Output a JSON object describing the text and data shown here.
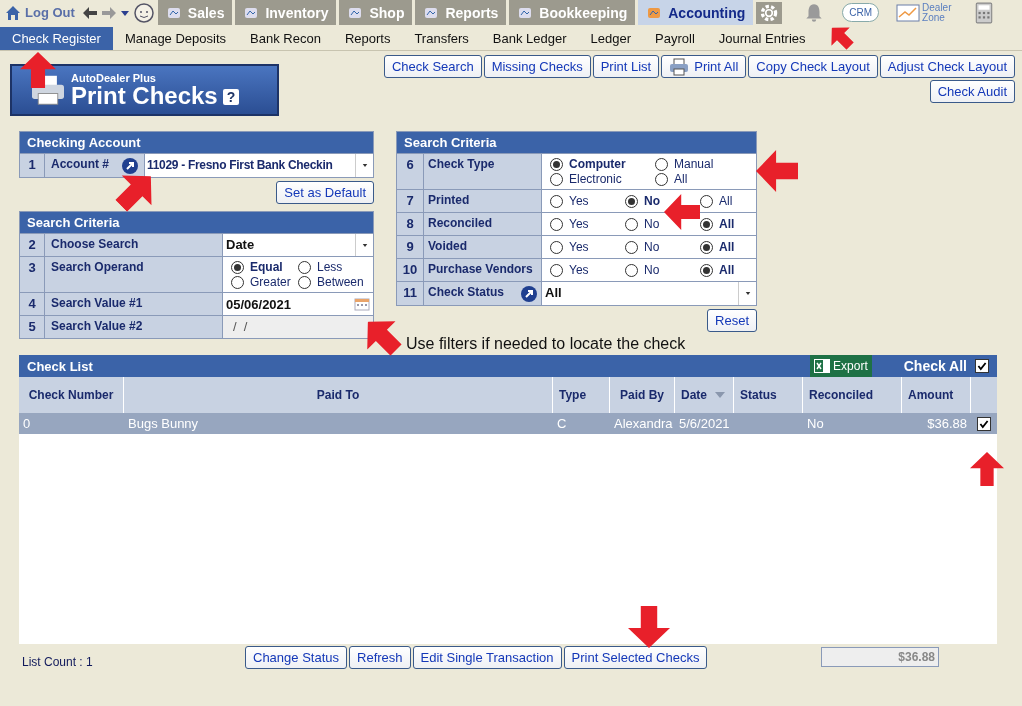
{
  "top_bar": {
    "logout": "Log Out",
    "tabs": [
      {
        "label": "Sales",
        "selected": false
      },
      {
        "label": "Inventory",
        "selected": false
      },
      {
        "label": "Shop",
        "selected": false
      },
      {
        "label": "Reports",
        "selected": false
      },
      {
        "label": "Bookkeeping",
        "selected": false
      },
      {
        "label": "Accounting",
        "selected": true
      }
    ],
    "crm": "CRM",
    "dealer_zone": "Dealer Zone"
  },
  "sub_nav": [
    {
      "label": "Check Register",
      "selected": true
    },
    {
      "label": "Manage Deposits",
      "selected": false
    },
    {
      "label": "Bank Recon",
      "selected": false
    },
    {
      "label": "Reports",
      "selected": false
    },
    {
      "label": "Transfers",
      "selected": false
    },
    {
      "label": "Bank Ledger",
      "selected": false
    },
    {
      "label": "Ledger",
      "selected": false
    },
    {
      "label": "Payroll",
      "selected": false
    },
    {
      "label": "Journal Entries",
      "selected": false
    }
  ],
  "header": {
    "brand": "AutoDealer Plus",
    "title": "Print Checks",
    "help": "?"
  },
  "toolbar": [
    {
      "label": "Check Search",
      "kind": "plain"
    },
    {
      "label": "Missing Checks",
      "kind": "plain"
    },
    {
      "label": "Print List",
      "kind": "plain"
    },
    {
      "label": "Print All",
      "kind": "printer"
    },
    {
      "label": "Copy Check Layout",
      "kind": "plain"
    },
    {
      "label": "Adjust Check Layout",
      "kind": "plain"
    },
    {
      "label": "Check Audit",
      "kind": "plain"
    }
  ],
  "checking_account": {
    "title": "Checking Account",
    "rows": [
      {
        "num": "1",
        "label": "Account #",
        "kind": "select",
        "link": true,
        "value": "11029 - Fresno First Bank Checkin"
      }
    ],
    "default_button": "Set as Default"
  },
  "search_left": {
    "title": "Search Criteria",
    "rows": [
      {
        "num": "2",
        "label": "Choose Search",
        "kind": "select",
        "value": "Date"
      },
      {
        "num": "3",
        "label": "Search Operand",
        "kind": "radio",
        "options": [
          {
            "label": "Equal",
            "selected": true
          },
          {
            "label": "Less",
            "selected": false
          },
          {
            "label": "Greater",
            "selected": false
          },
          {
            "label": "Between",
            "selected": false
          }
        ]
      },
      {
        "num": "4",
        "label": "Search Value #1",
        "kind": "date",
        "value": "05/06/2021"
      },
      {
        "num": "5",
        "label": "Search Value #2",
        "kind": "disabled",
        "value": "/  /"
      }
    ]
  },
  "search_right": {
    "title": "Search Criteria",
    "rows": [
      {
        "num": "6",
        "label": "Check Type",
        "kind": "radio",
        "options": [
          {
            "label": "Computer",
            "selected": true
          },
          {
            "label": "Manual",
            "selected": false
          },
          {
            "label": "Electronic",
            "selected": false
          },
          {
            "label": "All",
            "selected": false
          }
        ]
      },
      {
        "num": "7",
        "label": "Printed",
        "kind": "radio",
        "options": [
          {
            "label": "Yes",
            "selected": false
          },
          {
            "label": "No",
            "selected": true
          },
          {
            "label": "All",
            "selected": false
          }
        ]
      },
      {
        "num": "8",
        "label": "Reconciled",
        "kind": "radio",
        "options": [
          {
            "label": "Yes",
            "selected": false
          },
          {
            "label": "No",
            "selected": false
          },
          {
            "label": "All",
            "selected": true
          }
        ]
      },
      {
        "num": "9",
        "label": "Voided",
        "kind": "radio",
        "options": [
          {
            "label": "Yes",
            "selected": false
          },
          {
            "label": "No",
            "selected": false
          },
          {
            "label": "All",
            "selected": true
          }
        ]
      },
      {
        "num": "10",
        "label": "Purchase Vendors",
        "kind": "radio",
        "options": [
          {
            "label": "Yes",
            "selected": false
          },
          {
            "label": "No",
            "selected": false
          },
          {
            "label": "All",
            "selected": true
          }
        ]
      },
      {
        "num": "11",
        "label": "Check Status",
        "kind": "select",
        "link": true,
        "value": "All"
      }
    ],
    "reset_button": "Reset"
  },
  "note": "Use filters if needed to locate the check",
  "check_list": {
    "title": "Check List",
    "export": "Export",
    "check_all": {
      "label": "Check All",
      "checked": true
    },
    "columns": [
      "Check Number",
      "Paid To",
      "Type",
      "Paid By",
      "Date",
      "Status",
      "Reconciled",
      "Amount"
    ],
    "rows": [
      {
        "selected": true,
        "checked": true,
        "cells": [
          "0",
          "Bugs Bunny",
          "C",
          "Alexandra",
          "5/6/2021",
          "",
          "No",
          "$36.88"
        ]
      }
    ]
  },
  "footer": {
    "count": "List Count : 1",
    "buttons": [
      "Change Status",
      "Refresh",
      "Edit Single Transaction",
      "Print Selected Checks"
    ],
    "total": "$36.88"
  }
}
